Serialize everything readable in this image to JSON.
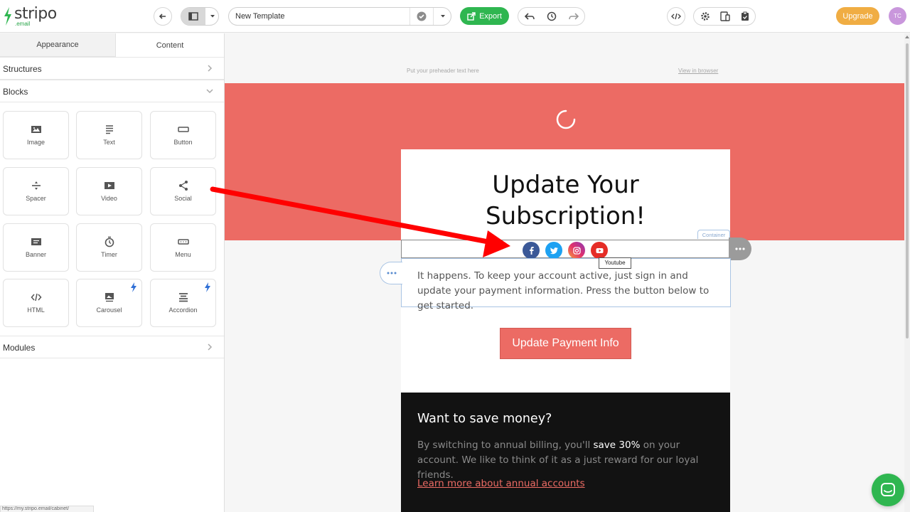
{
  "app": {
    "logo_text": "stripo",
    "logo_sub": ".email"
  },
  "toolbar": {
    "template_name": "New Template",
    "export_label": "Export",
    "upgrade_label": "Upgrade",
    "avatar_initials": "TC"
  },
  "sidebar": {
    "tabs": [
      {
        "label": "Appearance",
        "active": false
      },
      {
        "label": "Content",
        "active": true
      }
    ],
    "structures_label": "Structures",
    "blocks_label": "Blocks",
    "modules_label": "Modules",
    "blocks": [
      {
        "label": "Image",
        "icon": "image-icon"
      },
      {
        "label": "Text",
        "icon": "text-icon"
      },
      {
        "label": "Button",
        "icon": "button-icon"
      },
      {
        "label": "Spacer",
        "icon": "spacer-icon"
      },
      {
        "label": "Video",
        "icon": "video-icon"
      },
      {
        "label": "Social",
        "icon": "share-icon"
      },
      {
        "label": "Banner",
        "icon": "banner-icon"
      },
      {
        "label": "Timer",
        "icon": "timer-icon"
      },
      {
        "label": "Menu",
        "icon": "menu-icon"
      },
      {
        "label": "HTML",
        "icon": "code-icon"
      },
      {
        "label": "Carousel",
        "icon": "carousel-icon",
        "premium": true
      },
      {
        "label": "Accordion",
        "icon": "accordion-icon",
        "premium": true
      }
    ],
    "status_url": "https://my.stripo.email/cabinet/"
  },
  "canvas": {
    "preheader": "Put your preheader text here",
    "view_in_browser": "View in browser",
    "title_line1": "Update Your",
    "title_line2": "Subscription!",
    "container_tag": "Container",
    "tooltip": "Youtube",
    "body_text": "It happens. To keep your account active, just sign in and update your payment information. Press the button below to get started.",
    "cta_label": "Update Payment Info",
    "dark_title": "Want to save money?",
    "dark_body_1": "By switching to annual billing, you'll ",
    "dark_body_bold": "save 30%",
    "dark_body_2": " on your account. We like to think of it as a just reward for our loyal friends.",
    "dark_link": "Learn more about annual accounts"
  },
  "colors": {
    "brand_green": "#2fb650",
    "hero_red": "#ec6b64",
    "upgrade_orange": "#f0ad43",
    "facebook": "#3b5998",
    "twitter": "#1da1f2",
    "youtube": "#e52d27",
    "arrow": "#ff0000"
  }
}
